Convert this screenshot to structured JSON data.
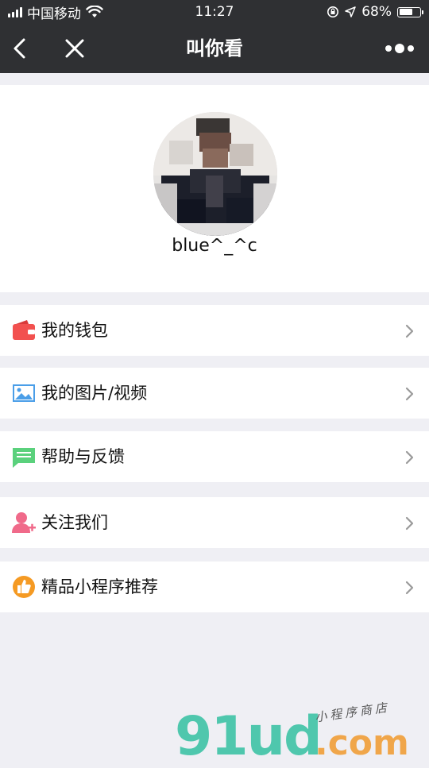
{
  "status_bar": {
    "carrier": "中国移动",
    "time": "11:27",
    "battery_percent": "68%",
    "battery_level": 0.68
  },
  "navbar": {
    "title": "叫你看"
  },
  "profile": {
    "username": "blue^_^c"
  },
  "menu": [
    {
      "label": "我的钱包",
      "icon": "wallet-icon",
      "color": "#f2514f"
    },
    {
      "label": "我的图片/视频",
      "icon": "image-icon",
      "color": "#4a9ee8"
    },
    {
      "label": "帮助与反馈",
      "icon": "message-icon",
      "color": "#5ad17c"
    },
    {
      "label": "关注我们",
      "icon": "user-add-icon",
      "color": "#f06a8a"
    },
    {
      "label": "精品小程序推荐",
      "icon": "thumbs-up-icon",
      "color": "#f59a23"
    }
  ],
  "watermark": {
    "brand": "91ud",
    "domain": ".com",
    "tagline": "小程序商店"
  }
}
